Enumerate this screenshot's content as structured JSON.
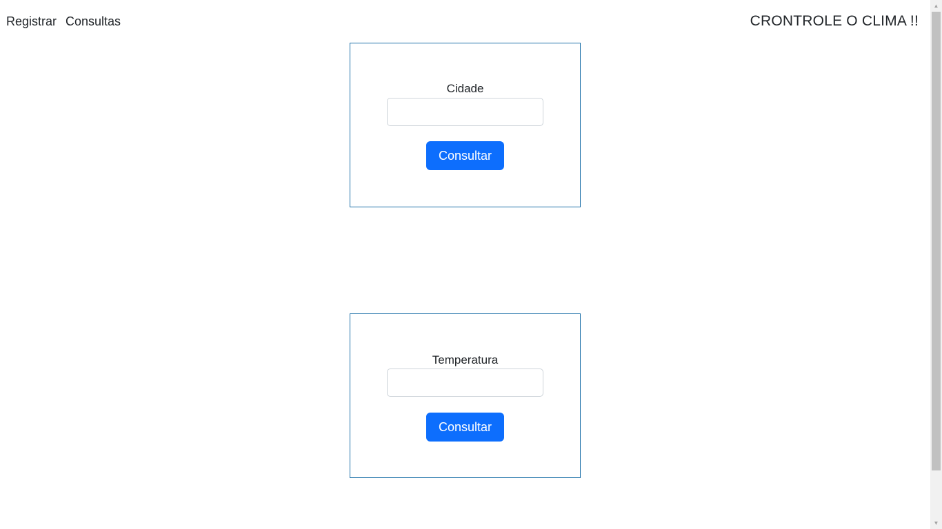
{
  "nav": {
    "links": [
      {
        "label": "Registrar"
      },
      {
        "label": "Consultas"
      }
    ],
    "brand": "CRONTROLE O CLIMA !!"
  },
  "cards": [
    {
      "label": "Cidade",
      "input_value": "",
      "button_label": "Consultar"
    },
    {
      "label": "Temperatura",
      "input_value": "",
      "button_label": "Consultar"
    }
  ],
  "colors": {
    "primary_button": "#0d6efd",
    "card_border": "#1b6fa8",
    "text": "#212529"
  },
  "scrollbar": {
    "up_icon": "scroll-up-arrow-icon",
    "down_icon": "scroll-down-arrow-icon"
  }
}
